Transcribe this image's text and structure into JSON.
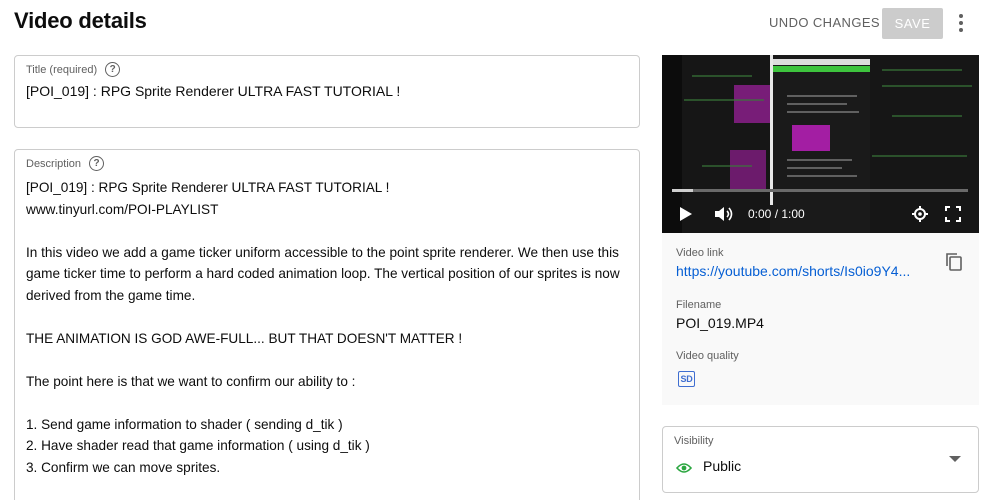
{
  "header": {
    "title": "Video details",
    "undo_label": "UNDO CHANGES",
    "save_label": "SAVE"
  },
  "title_field": {
    "label": "Title (required)",
    "value": "[POI_019] : RPG Sprite Renderer ULTRA FAST TUTORIAL !"
  },
  "description_field": {
    "label": "Description",
    "value": "[POI_019] : RPG Sprite Renderer ULTRA FAST TUTORIAL !\nwww.tinyurl.com/POI-PLAYLIST\n\nIn this video we add a game ticker uniform accessible to the point sprite renderer. We then use this game ticker time to perform a hard coded animation loop. The vertical position of our sprites is now derived from the game time.\n\nTHE ANIMATION IS GOD AWE-FULL... BUT THAT DOESN'T MATTER !\n\nThe point here is that we want to confirm our ability to :\n\n1. Send game information to shader ( sending d_tik )\n2. Have shader read that game information ( using d_tik )\n3. Confirm we can move sprites."
  },
  "preview": {
    "time": "0:00 / 1:00",
    "progress": 0.07,
    "video_link_label": "Video link",
    "video_link": "https://youtube.com/shorts/Is0io9Y4...",
    "filename_label": "Filename",
    "filename": "POI_019.MP4",
    "quality_label": "Video quality",
    "quality": "SD"
  },
  "visibility": {
    "label": "Visibility",
    "value": "Public",
    "icon": "eye-icon",
    "icon_color": "#2ba640"
  },
  "colors": {
    "link": "#065fd4",
    "save_disabled_bg": "#cccccc",
    "muted_text": "#606060"
  }
}
